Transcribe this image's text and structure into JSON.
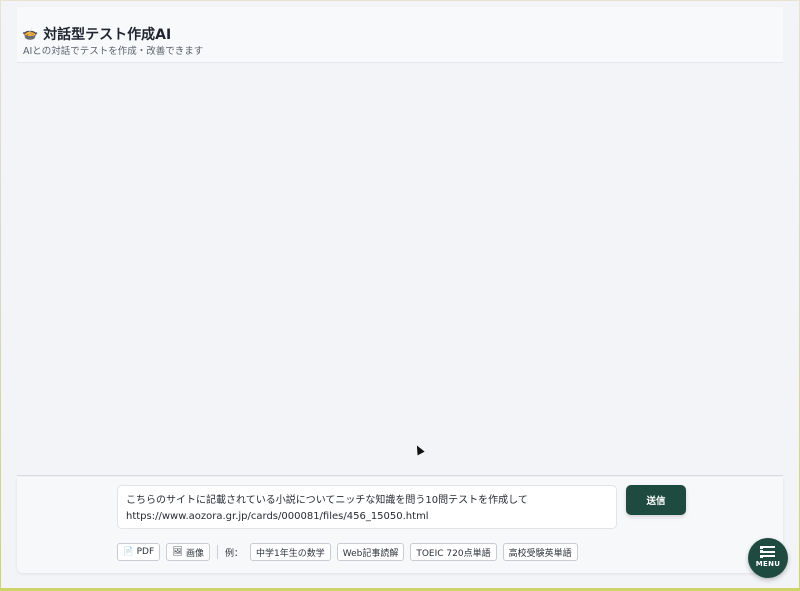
{
  "header": {
    "logo_icon": "🍲",
    "title": "対話型テスト作成AI",
    "subtitle": "AIとの対話でテストを作成・改善できます"
  },
  "composer": {
    "input_value": "こちらのサイトに記載されている小説についてニッチな知識を問う10問テストを作成して\nhttps://www.aozora.gr.jp/cards/000081/files/456_15050.html",
    "send_label": "送信",
    "attach": {
      "pdf_icon": "📄",
      "pdf_label": "PDF",
      "image_icon": "🖼",
      "image_label": "画像"
    },
    "examples_label": "例：",
    "examples": [
      "中学1年生の数学",
      "Web記事読解",
      "TOEIC 720点単語",
      "高校受験英単語"
    ]
  },
  "menu": {
    "label": "MENU"
  },
  "colors": {
    "accent": "#1e4a40",
    "background": "#f3f4f8"
  }
}
